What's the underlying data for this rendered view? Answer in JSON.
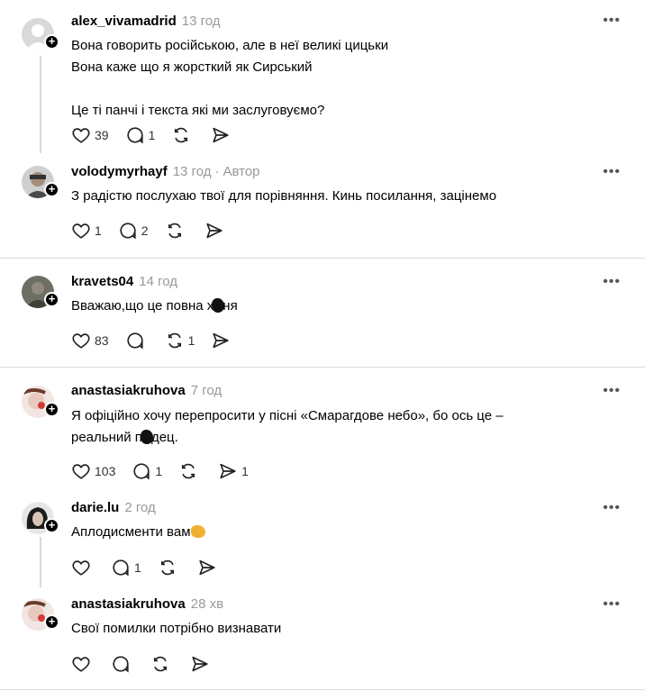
{
  "posts": [
    {
      "username": "alex_vivamadrid",
      "time": "13 год",
      "author_tag": "",
      "text": "Вона говорить російською, але в неї великі цицьки\nВона каже що я жорсткий як Сирський\n\nЦе ті панчі і текста які ми заслуговуємо?",
      "likes": "39",
      "replies": "1",
      "reposts": "",
      "shares": ""
    },
    {
      "username": "volodymyrhayf",
      "time": "13 год",
      "author_tag": "Автор",
      "text": "З радістю послухаю твої для порівняння. Кинь посилання, зацінемо",
      "likes": "1",
      "replies": "2",
      "reposts": "",
      "shares": ""
    },
    {
      "username": "kravets04",
      "time": "14 год",
      "author_tag": "",
      "text_a": "Вважаю,що це повна х",
      "text_b": "ня",
      "likes": "83",
      "replies": "",
      "reposts": "1",
      "shares": ""
    },
    {
      "username": "anastasiakruhova",
      "time": "7 год",
      "author_tag": "",
      "text_a": "Я офіційно хочу перепросити у пісні «Смарагдове небо», бо ось це –\nреальний п",
      "text_b": "дец.",
      "likes": "103",
      "replies": "1",
      "reposts": "",
      "shares": "1"
    },
    {
      "username": "darie.lu",
      "time": "2 год",
      "author_tag": "",
      "text": "Аплодисменти вам",
      "likes": "",
      "replies": "1",
      "reposts": "",
      "shares": ""
    },
    {
      "username": "anastasiakruhova",
      "time": "28 хв",
      "author_tag": "",
      "text": "Свої помилки потрібно визнавати",
      "likes": "",
      "replies": "",
      "reposts": "",
      "shares": ""
    }
  ],
  "more_label": "•••",
  "follow_badge": "+",
  "icons": {
    "like": "heart-icon",
    "reply": "comment-icon",
    "repost": "repost-icon",
    "share": "send-icon",
    "more": "more-icon"
  }
}
